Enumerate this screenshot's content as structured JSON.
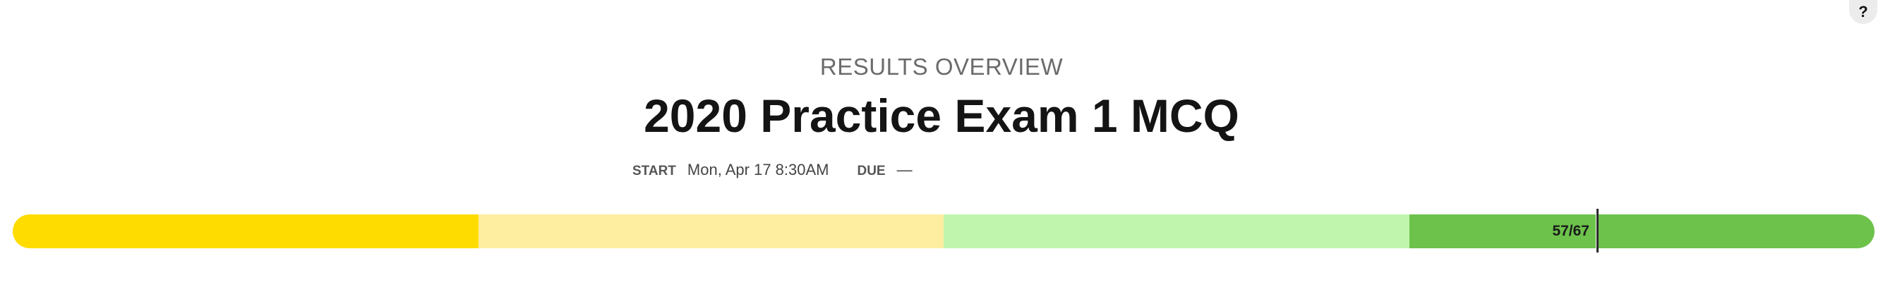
{
  "help": {
    "label": "?"
  },
  "header": {
    "subtitle": "RESULTS OVERVIEW",
    "title": "2020 Practice Exam 1 MCQ"
  },
  "meta": {
    "start_label": "START",
    "start_value": "Mon, Apr 17 8:30AM",
    "due_label": "DUE",
    "due_value": "—"
  },
  "progress": {
    "score_text": "57/67",
    "score": 57,
    "total": 67,
    "segments": [
      {
        "color": "#ffdc00"
      },
      {
        "color": "#feeea0"
      },
      {
        "color": "#c0f5ad"
      },
      {
        "color": "#6dc24b"
      }
    ]
  }
}
